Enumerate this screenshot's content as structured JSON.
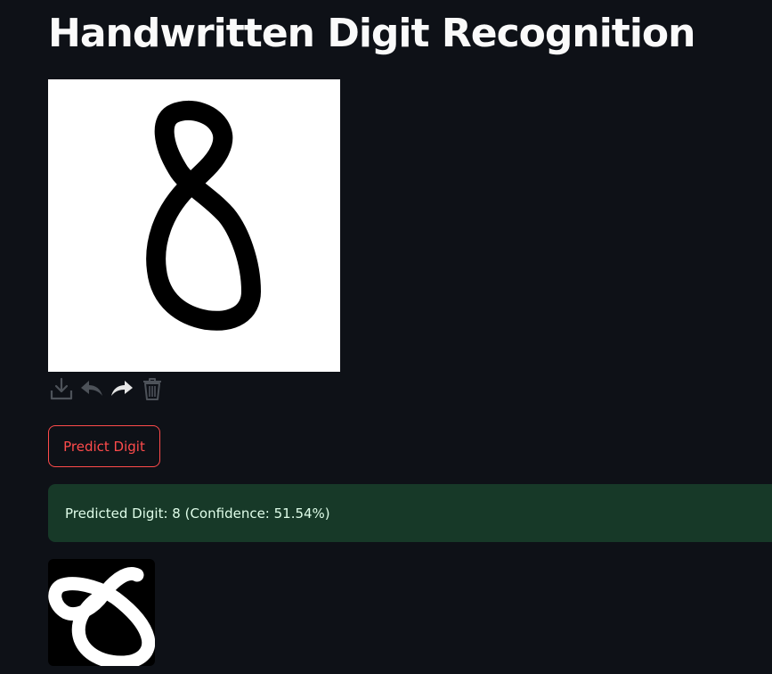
{
  "header": {
    "title": "Handwritten Digit Recognition"
  },
  "canvas": {
    "background_color": "#ffffff",
    "stroke_color": "#000000",
    "drawn_content": "digit 8"
  },
  "toolbar": {
    "items": [
      {
        "icon": "download-icon",
        "color": "#4d5259"
      },
      {
        "icon": "undo-icon",
        "color": "#4d5259"
      },
      {
        "icon": "redo-icon",
        "color": "#e6e6e6"
      },
      {
        "icon": "trash-icon",
        "color": "#4d5259"
      }
    ]
  },
  "actions": {
    "predict_label": "Predict Digit"
  },
  "result": {
    "message": "Predicted Digit: 8 (Confidence: 51.54%)",
    "background_color": "#173928",
    "text_color": "#dffde9"
  },
  "preview": {
    "background_color": "#000000",
    "stroke_color": "#ffffff",
    "shows": "processed 28x28 digit 8"
  },
  "colors": {
    "app_background": "#0e1117",
    "accent": "#ff4b4b",
    "text": "#fafafa"
  }
}
